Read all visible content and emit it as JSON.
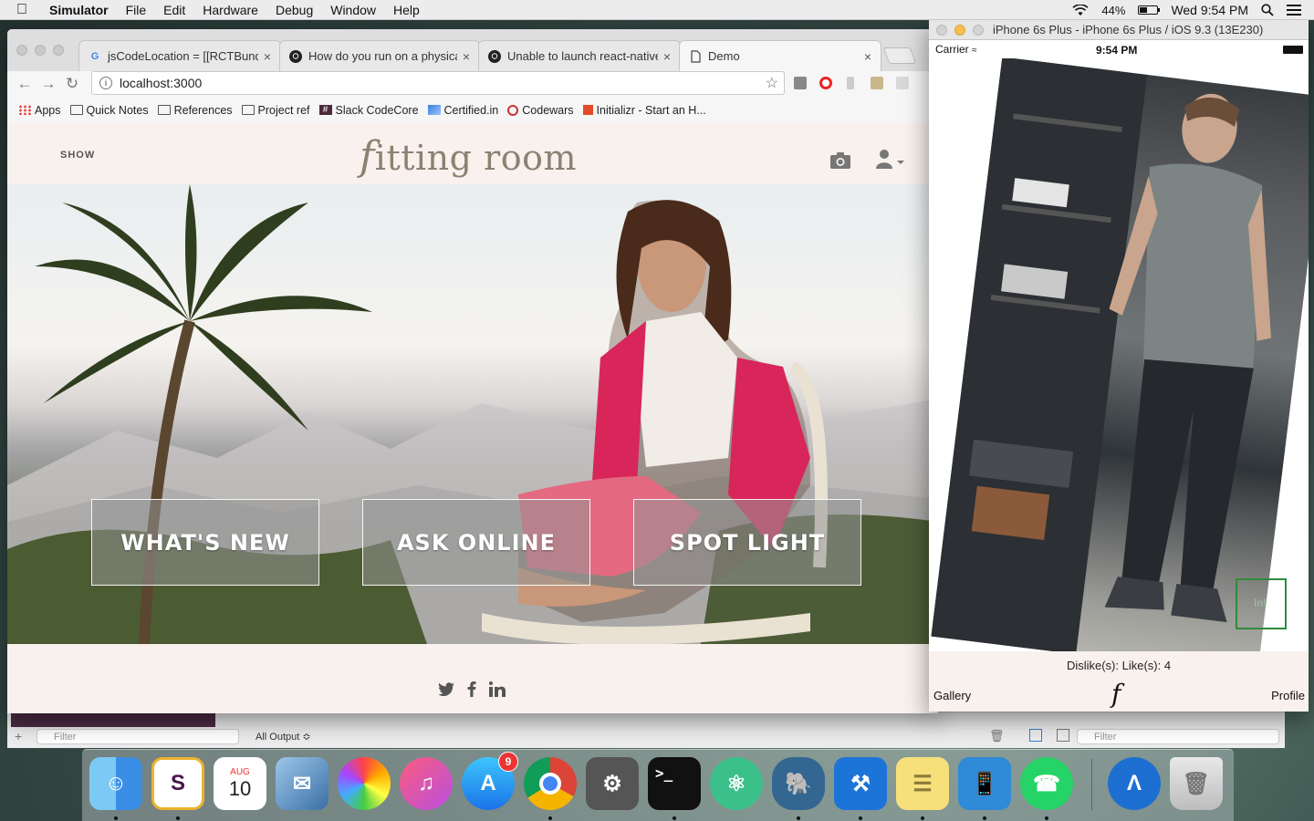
{
  "menubar": {
    "app_name": "Simulator",
    "items": [
      "File",
      "Edit",
      "Hardware",
      "Debug",
      "Window",
      "Help"
    ],
    "battery_percent": "44%",
    "battery_level": 0.44,
    "clock": "Wed 9:54 PM"
  },
  "browser": {
    "tabs": [
      {
        "title": "jsCodeLocation = [[RCTBundl",
        "icon": "google-icon"
      },
      {
        "title": "How do you run on a physical",
        "icon": "github-icon"
      },
      {
        "title": "Unable to launch react-native",
        "icon": "github-icon"
      },
      {
        "title": "Demo",
        "icon": "page-icon"
      }
    ],
    "close_glyph": "×",
    "url": "localhost:3000",
    "bookmarks": [
      "Apps",
      "Quick Notes",
      "References",
      "Project ref",
      "Slack CodeCore",
      "Certified.in",
      "Codewars",
      "Initializr - Start an H..."
    ]
  },
  "site": {
    "show_label": "SHOW",
    "logo_f": "f",
    "logo_rest": "itting room",
    "hero_buttons": [
      "WHAT'S NEW",
      "ASK ONLINE",
      "SPOT LIGHT"
    ],
    "social": [
      "twitter-icon",
      "facebook-icon",
      "linkedin-icon"
    ]
  },
  "xcode": {
    "filter_left": "Filter",
    "output": "All Output ≎",
    "filter_right": "Filter"
  },
  "simulator": {
    "title": "iPhone 6s Plus - iPhone 6s Plus / iOS 9.3 (13E230)",
    "carrier": "Carrier",
    "time": "9:54 PM",
    "likes_text": "Dislike(s):  Like(s): 4",
    "gallery": "Gallery",
    "profile": "Profile",
    "logo": "f",
    "overlay_tag": "In!"
  },
  "dock": {
    "calendar_month": "AUG",
    "calendar_day": "10",
    "appstore_badge": "9"
  },
  "colors": {
    "page_bg": "#f9f1ed",
    "logo": "#8d8172"
  }
}
